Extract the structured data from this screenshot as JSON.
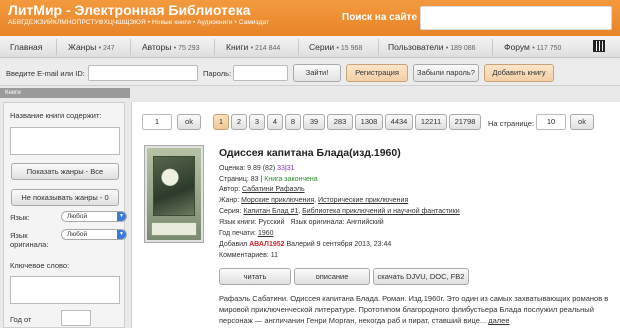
{
  "header": {
    "logo": "ЛитМир - Электронная Библиотека",
    "alphabet_line": "АБВГДЕЖЗИЙКЛМНОПРСТУФХЦЧШЩЭЮЯ",
    "header_links": "• Новые книги • Аудиокниги • Самиздат",
    "search_label": "Поиск на сайте",
    "search_value": ""
  },
  "nav": {
    "items": [
      {
        "label": "Главная",
        "count": ""
      },
      {
        "label": "Жанры",
        "count": "• 247"
      },
      {
        "label": "Авторы",
        "count": "• 75 293"
      },
      {
        "label": "Книги",
        "count": "• 214 844"
      },
      {
        "label": "Серии",
        "count": "• 15 968"
      },
      {
        "label": "Пользователи",
        "count": "• 189 086"
      },
      {
        "label": "Форум",
        "count": "• 117 750"
      }
    ]
  },
  "login": {
    "email_label": "Введите E-mail или ID:",
    "password_label": "Пароль:",
    "submit": "Зайти!",
    "register": "Регистрация",
    "forgot": "Забыли пароль?",
    "add_book": "Добавить книгу"
  },
  "section_strip": "Книги",
  "sidebar": {
    "title_label": "Название книги содержит:",
    "show_genres": "Показать жанры - Все",
    "hide_genres": "Не показывать жанры - 0",
    "lang_label": "Язык:",
    "lang_value": "Любой",
    "orig_lang_label_1": "Язык",
    "orig_lang_label_2": "оригинала:",
    "orig_lang_value": "Любой",
    "keyword_label": "Ключевое слово:",
    "year_from_label": "Год от"
  },
  "pager": {
    "page_input": "1",
    "ok1": "ok",
    "pages": [
      "1",
      "2",
      "3",
      "4",
      "8",
      "39",
      "283",
      "1308",
      "4434",
      "12211",
      "21798"
    ],
    "active_page": "1",
    "per_page_label": "На странице:",
    "per_page_value": "10",
    "ok2": "ok"
  },
  "book": {
    "title": "Одиссея капитана Блада(изд.1960)",
    "rating_label": "Оценка:",
    "rating_value": "9.89 (82)",
    "rating_extra": "33",
    "rating_extra2": "31",
    "pages_label": "Страниц:",
    "pages_value": "83",
    "finished": "Книга закончена",
    "author_label": "Автор:",
    "author": "Сабатини Рафаэль",
    "genre_label": "Жанр:",
    "genre1": "Морские приключения",
    "genre2": "Исторические приключения",
    "series_label": "Серия:",
    "series1": "Капитан Блад #1",
    "series2": "Библиотека приключений и научной фантастики",
    "lang_label": "Язык книги:",
    "lang": "Русский",
    "orig_label": "Язык оригинала:",
    "orig": "Английский",
    "year_label": "Год печати:",
    "year": "1960",
    "added_label": "Добавил",
    "added_user": "АВАЛ1952",
    "added_rest": "Валерий 9 сентября 2013, 23:44",
    "comments_label": "Комментариев:",
    "comments": "11",
    "btn_read": "читать",
    "btn_desc": "описание",
    "btn_download": "скачать DJVU, DOC, FB2",
    "description": "Рафаэль Сабатини. Одиссея капитана Блада. Роман. Изд.1960г. Это один из самых захватывающих романов в мировой приключенческой литературе. Прототипом благородного флибустьера Блада послужил реальный персонаж — англичанин Генри Морган, некогда раб и пират, ставший вице...",
    "more": "далее"
  }
}
